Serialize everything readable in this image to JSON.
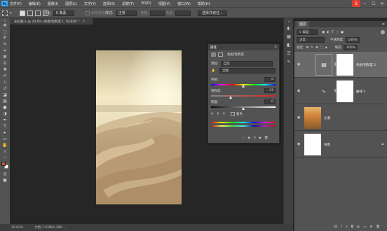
{
  "menu": [
    "文件(F)",
    "编辑(E)",
    "图像(I)",
    "图层(L)",
    "文字(Y)",
    "选择(S)",
    "滤镜(T)",
    "3D(D)",
    "视图(V)",
    "窗口(W)",
    "帮助(H)"
  ],
  "app_logo": "Ps",
  "window_controls": [
    "─",
    "☐",
    "✕"
  ],
  "ime_badge": "S",
  "options": {
    "feather_label": "羽化:",
    "feather_value": "0 像素",
    "antialias": "消除锯齿",
    "style_label": "样式:",
    "style_value": "正常",
    "width_label": "宽度:",
    "height_label": "高度:",
    "select_mask": "选择并遮住..."
  },
  "doc_tab": "未标题-1 @ 29.8% (色相/饱和度 1, RGB/8) *",
  "status": {
    "zoom": "29.82%",
    "doc": "文档:7.03M/9.38M"
  },
  "properties": {
    "tab": "属性",
    "subtitle": "色相/饱和度",
    "preset_label": "预设:",
    "preset_value": "自定",
    "channel_value": "全图",
    "hue_label": "色相:",
    "hue_value": "0",
    "hue_fraction": 0.5,
    "sat_label": "饱和度:",
    "sat_value": "-37",
    "sat_fraction": 0.315,
    "light_label": "明度:",
    "light_value": "0",
    "light_fraction": 0.5,
    "colorize": "着色"
  },
  "layers": {
    "tabs": [
      "图层"
    ],
    "kind_label": "类型",
    "blend_mode": "正常",
    "opacity_label": "不透明度:",
    "opacity_value": "100%",
    "lock_label": "锁定:",
    "fill_label": "填充:",
    "fill_value": "100%",
    "items": [
      {
        "name": "色相/饱和度 1",
        "type": "adjustment",
        "active": true
      },
      {
        "name": "曲线 1",
        "type": "curves",
        "active": false
      },
      {
        "name": "沙漠",
        "type": "image",
        "active": false
      },
      {
        "name": "背景",
        "type": "background",
        "active": false
      }
    ]
  },
  "colors": {
    "accent": "#31a8ff",
    "panel": "#535353",
    "canvas": "#262626",
    "foreground": "#d4552b",
    "background": "#ffffff"
  }
}
